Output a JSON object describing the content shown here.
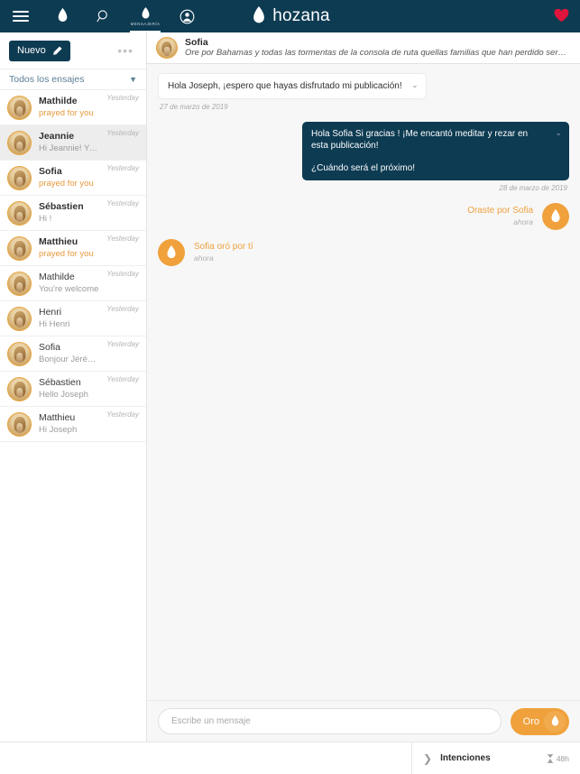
{
  "topbar": {
    "menu_icon": "hamburger-icon",
    "flame_icon": "flame-icon",
    "search_icon": "search-icon",
    "messaging_label": "MENSAJERÍA",
    "profile_icon": "user-icon",
    "brand": "hozana",
    "heart_icon": "heart-icon",
    "bg_color": "#0d3b52"
  },
  "sidebar": {
    "new_button": "Nuevo",
    "pencil_icon": "pencil-icon",
    "more_icon": "more-options-icon",
    "filter_label": "Todos los ensajes",
    "filter_chevron": "chevron-down-icon",
    "conversations": [
      {
        "name": "Mathilde",
        "preview": "prayed for you",
        "time": "Yesterday",
        "prayed": true,
        "selected": false,
        "bold": true
      },
      {
        "name": "Jeannie",
        "preview": "Hi Jeannie! Yes thanks ! I",
        "time": "Yesterday",
        "prayed": false,
        "selected": true,
        "bold": true
      },
      {
        "name": "Sofia",
        "preview": "prayed for you",
        "time": "Yesterday",
        "prayed": true,
        "selected": false,
        "bold": true
      },
      {
        "name": "Sébastien",
        "preview": "Hi !",
        "time": "Yesterday",
        "prayed": false,
        "selected": false,
        "bold": true
      },
      {
        "name": "Matthieu",
        "preview": "prayed for you",
        "time": "Yesterday",
        "prayed": true,
        "selected": false,
        "bold": true
      },
      {
        "name": "Mathilde",
        "preview": "You're welcome",
        "time": "Yesterday",
        "prayed": false,
        "selected": false,
        "bold": false
      },
      {
        "name": "Henri",
        "preview": "Hi Henri",
        "time": "Yesterday",
        "prayed": false,
        "selected": false,
        "bold": false
      },
      {
        "name": "Sofia",
        "preview": "Bonjour Jérémie !",
        "time": "Yesterday",
        "prayed": false,
        "selected": false,
        "bold": false
      },
      {
        "name": "Sébastien",
        "preview": "Hello Joseph",
        "time": "Yesterday",
        "prayed": false,
        "selected": false,
        "bold": false
      },
      {
        "name": "Matthieu",
        "preview": "Hi Joseph",
        "time": "Yesterday",
        "prayed": false,
        "selected": false,
        "bold": false
      }
    ]
  },
  "chat": {
    "header": {
      "name": "Sofia",
      "subtitle": "Ore por Bahamas y todas las tormentas de la consola de ruta quellas familias que han perdido seres queridos."
    },
    "messages": [
      {
        "kind": "in",
        "text": "Hola Joseph, ¡espero que hayas disfrutado mi publicación!",
        "stamp": "27 de marzo de 2019",
        "chevron": "chevron-down-icon"
      },
      {
        "kind": "out",
        "text": "Hola Sofia Si gracias ! ¡Me encantó meditar y rezar en esta publicación!\n\n¿Cuándo será el próximo!",
        "stamp": "28 de marzo de 2019",
        "chevron": "chevron-down-icon"
      }
    ],
    "prayer_out": {
      "title": "Oraste por Sofia",
      "time": "ahora",
      "icon": "flame-icon"
    },
    "prayer_in": {
      "title": "Sofia oró por tí",
      "time": "ahora",
      "icon": "flame-icon"
    }
  },
  "composer": {
    "placeholder": "Escribe un mensaje",
    "value": "",
    "oro_label": "Oro",
    "oro_icon": "flame-icon",
    "accent_color": "#f0a13c"
  },
  "bottombar": {
    "chevron": "chevron-right-icon",
    "title": "Intenciones",
    "timer_icon": "hourglass-icon",
    "timer_text": "48h"
  }
}
